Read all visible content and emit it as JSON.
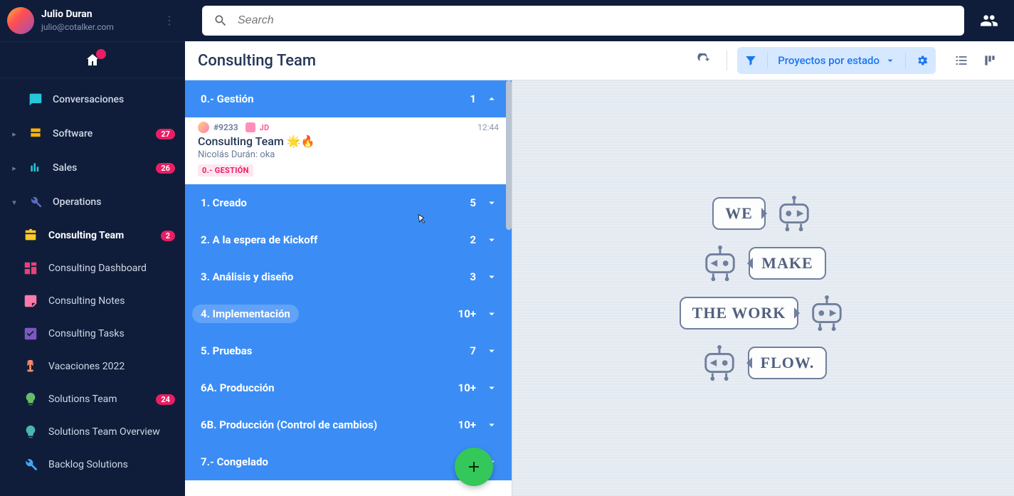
{
  "profile": {
    "name": "Julio Duran",
    "email": "julio@cotalker.com"
  },
  "search": {
    "placeholder": "Search"
  },
  "sidebar": {
    "top": [
      {
        "label": "Conversaciones"
      },
      {
        "label": "Software",
        "badge": "27",
        "expandable": true
      },
      {
        "label": "Sales",
        "badge": "26",
        "expandable": true
      },
      {
        "label": "Operations",
        "expandable": true,
        "expanded": true
      }
    ],
    "ops": [
      {
        "label": "Consulting Team",
        "badge": "2",
        "active": true
      },
      {
        "label": "Consulting Dashboard"
      },
      {
        "label": "Consulting Notes"
      },
      {
        "label": "Consulting Tasks"
      },
      {
        "label": "Vacaciones 2022"
      },
      {
        "label": "Solutions Team",
        "badge": "24"
      },
      {
        "label": "Solutions Team Overview"
      },
      {
        "label": "Backlog Solutions"
      }
    ]
  },
  "header": {
    "title": "Consulting Team",
    "filter_label": "Proyectos por estado"
  },
  "groups": [
    {
      "label": "0.- Gestión",
      "count": "1",
      "expanded": true
    },
    {
      "label": "1. Creado",
      "count": "5"
    },
    {
      "label": "2. A la espera de Kickoff",
      "count": "2"
    },
    {
      "label": "3. Análisis y diseño",
      "count": "3"
    },
    {
      "label": "4. Implementación",
      "count": "10+",
      "hover": true
    },
    {
      "label": "5. Pruebas",
      "count": "7"
    },
    {
      "label": "6A. Producción",
      "count": "10+"
    },
    {
      "label": "6B. Producción (Control de cambios)",
      "count": "10+"
    },
    {
      "label": "7.- Congelado",
      "count": ""
    }
  ],
  "card": {
    "id": "#9233",
    "assignee": "JD",
    "time": "12:44",
    "title": "Consulting Team 🌟🔥",
    "subtitle": "Nicolás Durán: oka",
    "tag": "0.- GESTIÓN"
  },
  "placeholder": {
    "w1": "WE",
    "w2": "MAKE",
    "w3": "THE WORK",
    "w4": "FLOW."
  }
}
